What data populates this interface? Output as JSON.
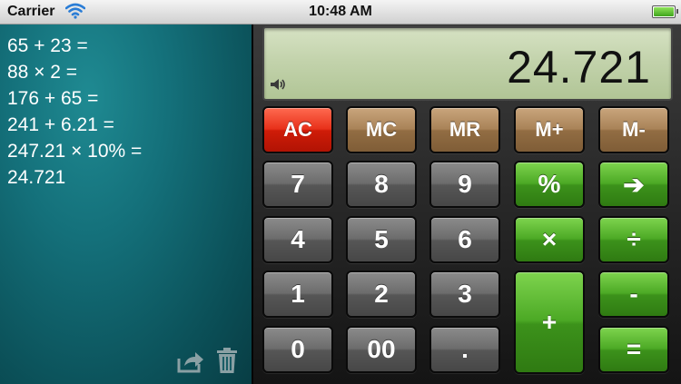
{
  "status_bar": {
    "carrier": "Carrier",
    "time": "10:48 AM"
  },
  "tape": {
    "lines": [
      "65 + 23 =",
      "88 × 2 =",
      "176 + 65 =",
      "241 + 6.21 =",
      "247.21 × 10% =",
      "24.721"
    ],
    "share_icon": "share-icon",
    "trash_icon": "trash-icon"
  },
  "display": {
    "value": "24.721",
    "speaker_icon": "speaker-icon"
  },
  "keys": {
    "ac": "AC",
    "mc": "MC",
    "mr": "MR",
    "m_plus": "M+",
    "m_minus": "M-",
    "seven": "7",
    "eight": "8",
    "nine": "9",
    "percent": "%",
    "backspace": "➔",
    "four": "4",
    "five": "5",
    "six": "6",
    "multiply": "×",
    "divide": "÷",
    "one": "1",
    "two": "2",
    "three": "3",
    "minus": "-",
    "plus": "+",
    "zero": "0",
    "double_zero": "00",
    "decimal": ".",
    "equals": "="
  },
  "colors": {
    "memory_key": "#a98358",
    "clear_key": "#e8311a",
    "digit_key": "#6c6c6c",
    "operator_key": "#4ca925",
    "lcd": "#c3d3ac",
    "tape": "#14707a"
  }
}
